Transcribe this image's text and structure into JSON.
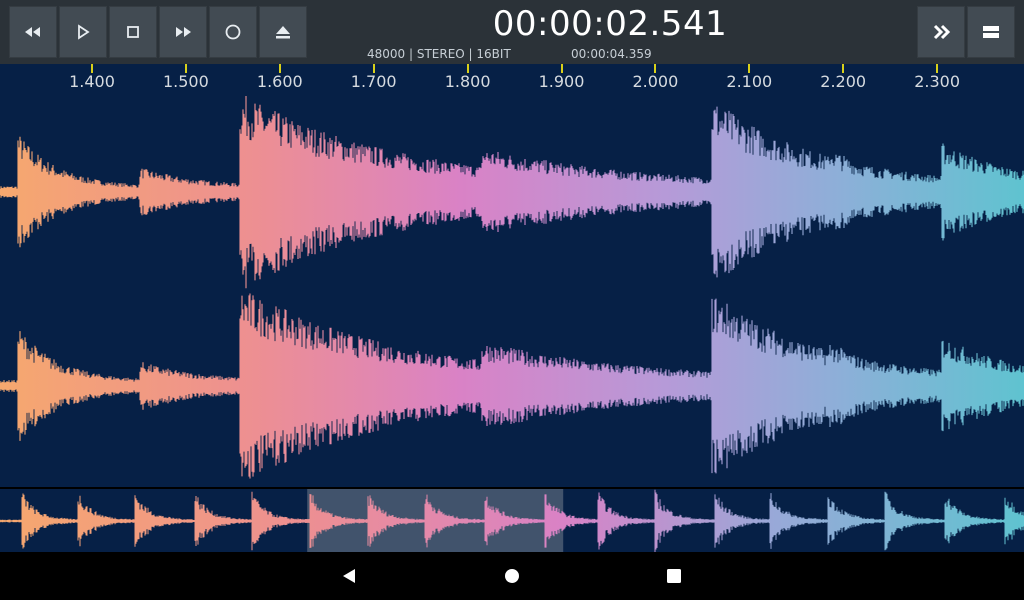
{
  "transport": {
    "buttons": [
      {
        "name": "rewind-button",
        "icon": "rewind-icon"
      },
      {
        "name": "play-button",
        "icon": "play-icon"
      },
      {
        "name": "stop-button",
        "icon": "stop-icon"
      },
      {
        "name": "fast-forward-button",
        "icon": "fast-forward-icon"
      },
      {
        "name": "record-button",
        "icon": "record-icon"
      },
      {
        "name": "eject-button",
        "icon": "eject-icon"
      }
    ]
  },
  "header": {
    "timecode": "00:00:02.541",
    "format": "48000 | STEREO | 16BIT",
    "duration": "00:00:04.359"
  },
  "right_buttons": [
    {
      "name": "skip-forward-button",
      "icon": "double-chevron-right-icon"
    },
    {
      "name": "menu-button",
      "icon": "menu-icon"
    }
  ],
  "ruler": {
    "labels": [
      "1.400",
      "1.500",
      "1.600",
      "1.700",
      "1.800",
      "1.900",
      "2.000",
      "2.100",
      "2.200",
      "2.300"
    ]
  },
  "colors": {
    "background": "#062046",
    "gradient": [
      "#f6a86e",
      "#ed8f92",
      "#d982c6",
      "#b69ad8",
      "#8dafd8",
      "#5fc3d0"
    ],
    "tick": "#d8d01a",
    "selection": "#56647a"
  },
  "overview": {
    "selection_start_fraction": 0.3,
    "selection_end_fraction": 0.55
  },
  "navbar": {
    "buttons": [
      {
        "name": "back-button",
        "icon": "back-triangle-icon"
      },
      {
        "name": "home-button",
        "icon": "home-circle-icon"
      },
      {
        "name": "recents-button",
        "icon": "recents-square-icon"
      }
    ]
  }
}
